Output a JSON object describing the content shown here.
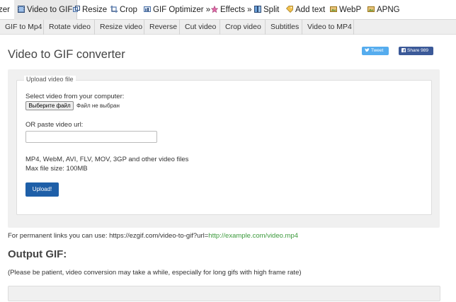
{
  "topnav": {
    "items": [
      {
        "label": "zer",
        "icon": "none"
      },
      {
        "label": "Video to GIF",
        "icon": "film-icon",
        "active": true
      },
      {
        "label": "Resize",
        "icon": "resize-icon"
      },
      {
        "label": "Crop",
        "icon": "crop-icon"
      },
      {
        "label": "GIF Optimizer »",
        "icon": "optimizer-icon"
      },
      {
        "label": "Effects »",
        "icon": "effects-icon"
      },
      {
        "label": "Split",
        "icon": "split-icon"
      },
      {
        "label": "Add text",
        "icon": "text-icon"
      },
      {
        "label": "WebP",
        "icon": "webp-icon"
      },
      {
        "label": "APNG",
        "icon": "apng-icon"
      }
    ]
  },
  "subnav": {
    "tabs": [
      "GIF to Mp4",
      "Rotate video",
      "Resize video",
      "Reverse",
      "Cut video",
      "Crop video",
      "Subtitles",
      "Video to MP4"
    ]
  },
  "page": {
    "title": "Video to GIF converter"
  },
  "share": {
    "tweet_label": "Tweet",
    "fb_label": "Share 989",
    "tweet_color": "#55acee",
    "fb_color": "#3b5998"
  },
  "upload": {
    "legend": "Upload video file",
    "select_label": "Select video from your computer:",
    "file_button": "Выберите файл",
    "file_status": "Файл не выбран",
    "url_label": "OR paste video url:",
    "url_value": "",
    "formats": "MP4, WebM, AVI, FLV, MOV, 3GP and other video files",
    "max_size": "Max file size: 100MB",
    "upload_button": "Upload!",
    "upload_color": "#1e5fa8"
  },
  "permanent": {
    "prefix": "For permanent links you can use: https://ezgif.com/video-to-gif?url=",
    "link": "http://example.com/video.mp4",
    "link_color": "#3c9a3c"
  },
  "output": {
    "title": "Output GIF:",
    "note": "(Please be patient, video conversion may take a while, especially for long gifs with high frame rate)"
  }
}
